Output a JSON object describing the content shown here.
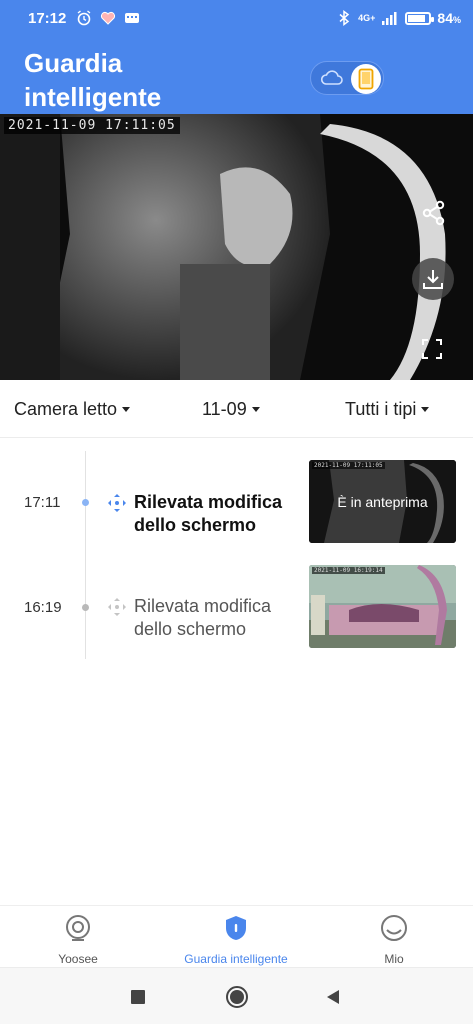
{
  "status_bar": {
    "time": "17:12",
    "network": "4G+",
    "battery_percent_text": "84",
    "battery_level": 0.84,
    "icons": [
      "alarm-icon",
      "heart-icon",
      "keyboard-icon",
      "bluetooth-icon",
      "signal-icon",
      "battery-icon"
    ]
  },
  "header": {
    "title_line1": "Guardia",
    "title_line2": "intelligente",
    "toggle": {
      "left_icon": "cloud-icon",
      "right_icon": "phone-icon",
      "selected": "phone"
    }
  },
  "video": {
    "timestamp": "2021-11-09  17:11:05",
    "buttons": [
      "share-icon",
      "download-icon",
      "fullscreen-icon"
    ]
  },
  "filters": {
    "camera": "Camera letto",
    "date": "11-09",
    "type": "Tutti i tipi"
  },
  "events": [
    {
      "time": "17:11",
      "label": "Rilevata modifica dello schermo",
      "active": true,
      "thumb_timestamp": "2021-11-09  17:11:05",
      "thumb_overlay": "È in anteprima"
    },
    {
      "time": "16:19",
      "label": "Rilevata modifica dello schermo",
      "active": false,
      "thumb_timestamp": "2021-11-09  16:19:14"
    }
  ],
  "bottom_nav": [
    {
      "label": "Yoosee",
      "icon": "camera-icon",
      "active": false
    },
    {
      "label": "Guardia intelligente",
      "icon": "shield-icon",
      "active": true
    },
    {
      "label": "Mio",
      "icon": "profile-icon",
      "active": false
    }
  ],
  "colors": {
    "brand": "#4a86ec",
    "active_dot": "#8ab4f5",
    "inactive_dot": "#b9b9b9"
  }
}
